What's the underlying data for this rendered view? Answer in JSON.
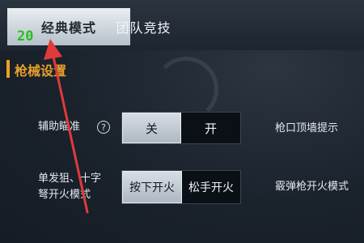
{
  "tabs": [
    {
      "label": "经典模式",
      "active": true
    },
    {
      "label": "团队竞技",
      "active": false
    }
  ],
  "overlay_number": "20",
  "section_title": "枪械设置",
  "settings": {
    "aim_assist": {
      "label": "辅助瞄准",
      "help_icon": "?",
      "options": [
        "关",
        "开"
      ],
      "selected": "关"
    },
    "muzzle_hint": {
      "label": "枪口顶墙提示"
    },
    "fire_mode": {
      "label_line1": "单发狙、十字",
      "label_line2": "弩开火模式",
      "options": [
        "按下开火",
        "松手开火"
      ],
      "selected": "按下开火"
    },
    "shotgun_fire": {
      "label": "霰弹枪开火模式"
    }
  },
  "colors": {
    "accent": "#f0a020",
    "annotation_arrow": "#e03a3a",
    "annotation_number": "#22c21d"
  }
}
